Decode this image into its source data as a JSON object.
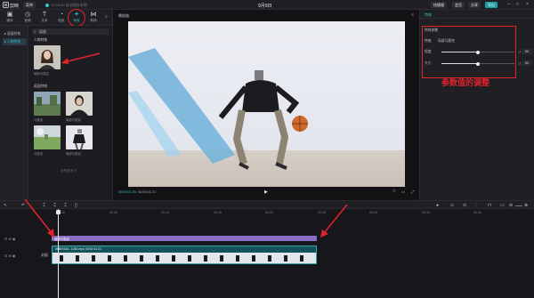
{
  "topbar": {
    "app_name": "剪映",
    "menu_label": "菜单",
    "autosave": "13:33:30 自动保存本地",
    "project_title": "9月9日",
    "shortcut_btn": "快捷键",
    "pro_btn": "会员",
    "share_btn": "分享",
    "export_btn": "导出"
  },
  "tooltabs": [
    {
      "icon": "media-icon",
      "label": "媒体"
    },
    {
      "icon": "audio-icon",
      "label": "音频"
    },
    {
      "icon": "text-icon",
      "label": "文本"
    },
    {
      "icon": "sticker-icon",
      "label": "贴纸"
    },
    {
      "icon": "effects-icon",
      "label": "特效"
    },
    {
      "icon": "transition-icon",
      "label": "转场"
    }
  ],
  "leftnav": {
    "items": [
      "画面特效",
      "人物特效"
    ],
    "active_index": 1
  },
  "assets": {
    "search_value": "局部",
    "section1_title": "人物特效",
    "item1_label": "局部马赛克",
    "section2_title": "画面特效",
    "items2": [
      "马赛克",
      "局部马赛克",
      "马赛克",
      "局部马赛克"
    ],
    "more_text": "没有更多了"
  },
  "player": {
    "title": "播放器",
    "timecode_current": "00:00:01:00",
    "timecode_total": "00:00:41:21"
  },
  "rightpanel": {
    "tab": "特效",
    "section_title": "特效参数",
    "effect_label": "特效",
    "effect_value": "局部马赛克",
    "param1_label": "程度",
    "param1_value": 50,
    "param2_label": "大小",
    "param2_value": 50,
    "annotation": "参数值的调整"
  },
  "timeline": {
    "ruler_labels": [
      "00:00",
      "00:05",
      "00:10",
      "00:15",
      "00:20",
      "00:25",
      "00:30",
      "00:35",
      "00:40"
    ],
    "fx_clip_label": "局部马赛克",
    "video_clip_label": "5b8b7d3d...1280.mp4  00:00:41:21",
    "cover_label": "封面"
  },
  "colors": {
    "accent": "#35c4c9",
    "annotation_red": "#e3232b",
    "fx_clip": "#8a6fc4",
    "video_clip": "#14535a"
  }
}
